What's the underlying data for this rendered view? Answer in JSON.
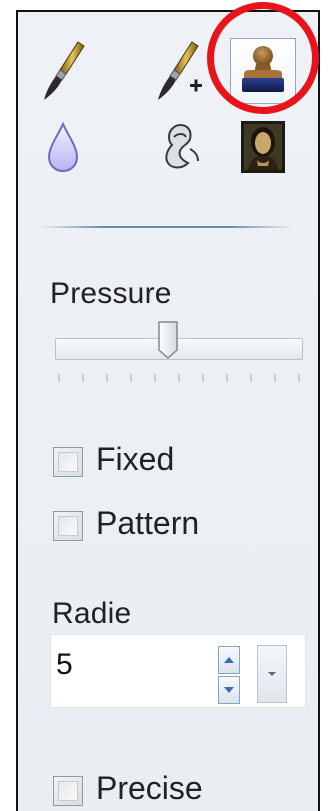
{
  "tools": {
    "row1": [
      {
        "icon": "brush-icon",
        "selected": false
      },
      {
        "icon": "brush-plus-icon",
        "selected": false
      },
      {
        "icon": "stamp-icon",
        "selected": true
      }
    ],
    "row2": [
      {
        "icon": "drop-icon",
        "selected": false
      },
      {
        "icon": "smudge-icon",
        "selected": false
      },
      {
        "icon": "portrait-icon",
        "selected": false
      }
    ],
    "highlight_color": "#e8141b"
  },
  "pressure": {
    "label": "Pressure",
    "slider_value_fraction": 0.45
  },
  "options": {
    "fixed": {
      "label": "Fixed",
      "checked": false
    },
    "pattern": {
      "label": "Pattern",
      "checked": false
    },
    "precise": {
      "label": "Precise",
      "checked": false
    }
  },
  "radius": {
    "label": "Radie",
    "value": "5"
  }
}
